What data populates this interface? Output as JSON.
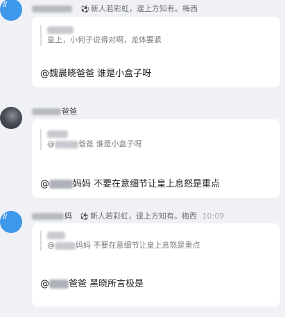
{
  "messages": [
    {
      "sender_suffix": "",
      "signature": "新人若彩虹，遑上方知有。梅西",
      "time": "",
      "quote_author": "",
      "quote_text": "皇上，小何子说得对啊，龙体要紧",
      "reply": "@魏晨晓爸爸 谁是小盒子呀"
    },
    {
      "sender_suffix": "爸爸",
      "signature": "",
      "time": "",
      "quote_author": "",
      "quote_text_prefix": "@",
      "quote_text": "爸爸 谁是小盒子呀",
      "reply_prefix": "@",
      "reply": "妈妈 不要在意细节让皇上息怒是重点"
    },
    {
      "sender_suffix": "妈",
      "signature": "新人若彩虹，遑上方知有。梅西",
      "time": "10:09",
      "quote_author": "",
      "quote_text_prefix": "@",
      "quote_text": "妈妈 不要在意细节让皇上息怒是重点",
      "reply_prefix": "@",
      "reply": "爸爸 黑晓所言极是"
    }
  ],
  "icons": {
    "signature_icon": "soccer-ball-icon"
  },
  "colors": {
    "background": "#f0f1f4",
    "card": "#ffffff",
    "avatar_blue": "#3d97ea"
  }
}
